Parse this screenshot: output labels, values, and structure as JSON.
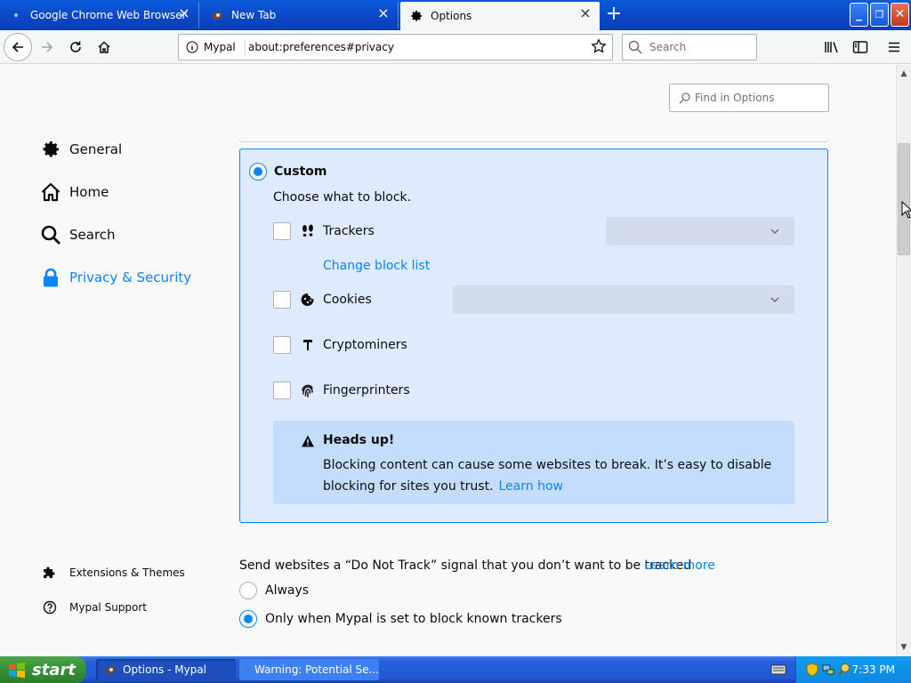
{
  "tabs": [
    {
      "title": "Google Chrome Web Browser",
      "icon": "chrome-dot-icon"
    },
    {
      "title": "New Tab",
      "icon": "mypal-icon"
    },
    {
      "title": "Options",
      "icon": "gear-icon"
    }
  ],
  "toolbar": {
    "identity_label": "Mypal",
    "url": "about:preferences#privacy",
    "search_placeholder": "Search"
  },
  "options": {
    "find_placeholder": "Find in Options",
    "categories": [
      {
        "label": "General",
        "icon": "gear-icon"
      },
      {
        "label": "Home",
        "icon": "home-icon"
      },
      {
        "label": "Search",
        "icon": "search-icon"
      },
      {
        "label": "Privacy & Security",
        "icon": "lock-icon"
      }
    ],
    "footer": [
      {
        "label": "Extensions & Themes",
        "icon": "puzzle-icon"
      },
      {
        "label": "Mypal Support",
        "icon": "help-icon"
      }
    ],
    "custom": {
      "title": "Custom",
      "subtitle": "Choose what to block.",
      "items": [
        {
          "label": "Trackers",
          "icon": "footprints-icon",
          "checked": false
        },
        {
          "label": "Cookies",
          "icon": "cookie-icon",
          "checked": false
        },
        {
          "label": "Cryptominers",
          "icon": "hammer-icon",
          "checked": false
        },
        {
          "label": "Fingerprinters",
          "icon": "fingerprint-icon",
          "checked": false
        }
      ],
      "change_block_list": "Change block list",
      "headsup": {
        "title": "Heads up!",
        "body": "Blocking content can cause some websites to break. It’s easy to disable blocking for sites you trust.",
        "link": "Learn how"
      }
    },
    "dnt": {
      "label": "Send websites a “Do Not Track” signal that you don’t want to be tracked",
      "learn_more": "Learn more",
      "options": [
        {
          "label": "Always",
          "selected": false
        },
        {
          "label": "Only when Mypal is set to block known trackers",
          "selected": true
        }
      ]
    }
  },
  "taskbar": {
    "start_label": "start",
    "tasks": [
      {
        "label": "Options - Mypal",
        "active": true
      },
      {
        "label": "Warning: Potential Se...",
        "active": false
      }
    ],
    "clock": "7:33 PM"
  },
  "colors": {
    "accent": "#0a84ff",
    "custom_box_bg": "#deeafd",
    "headsup_bg": "#c5ddfc",
    "xp_blue": "#245edb",
    "start_green": "#37943a"
  }
}
